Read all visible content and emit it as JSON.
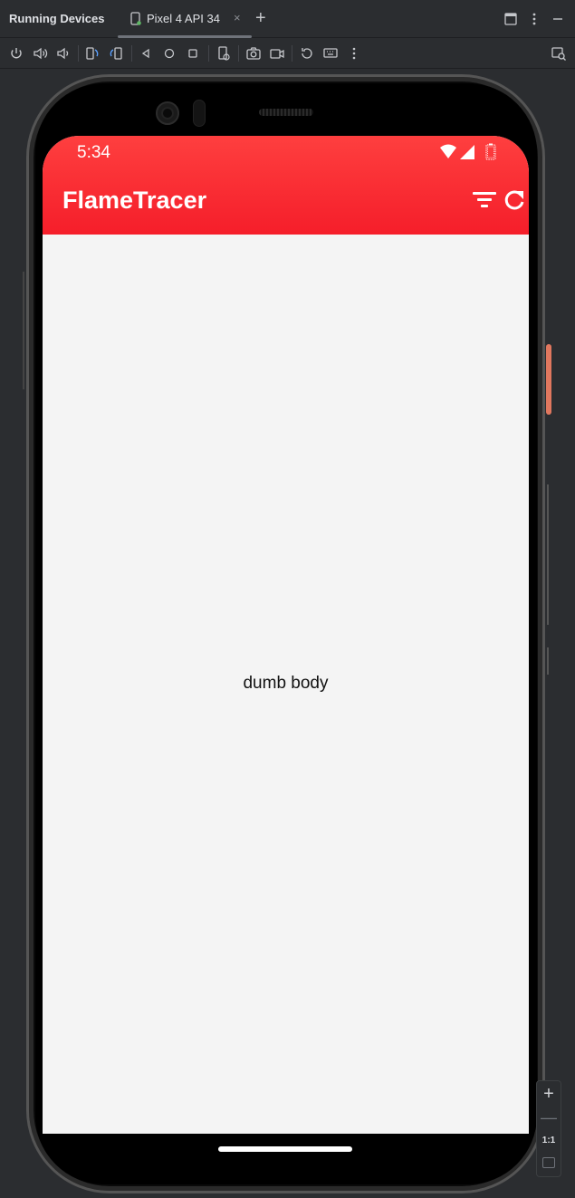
{
  "ide": {
    "panel_title": "Running Devices",
    "device_tab": {
      "label": "Pixel 4 API 34",
      "icon": "device-icon",
      "close_glyph": "×"
    },
    "add_tab_glyph": "+",
    "toolbar_icons": [
      "power-icon",
      "volume-up-icon",
      "volume-down-icon",
      "rotate-left-icon",
      "rotate-right-icon",
      "back-icon",
      "home-icon",
      "overview-icon",
      "device-frame-icon",
      "screenshot-icon",
      "screen-record-icon",
      "reset-icon",
      "keyboard-icon",
      "more-icon",
      "device-explorer-icon"
    ]
  },
  "phone": {
    "status_bar": {
      "time": "5:34",
      "icons": [
        "wifi-icon",
        "cell-signal-icon",
        "battery-icon"
      ]
    },
    "app_bar": {
      "title": "FlameTracer",
      "actions": [
        "filter-icon",
        "refresh-icon"
      ],
      "color_top": "#fe3f3f",
      "color_bottom": "#f51e2a"
    },
    "body": {
      "text": "dumb body",
      "background": "#f4f4f4"
    }
  },
  "zoom": {
    "zoom_in": "+",
    "zoom_out": "—",
    "actual_size": "1:1"
  }
}
